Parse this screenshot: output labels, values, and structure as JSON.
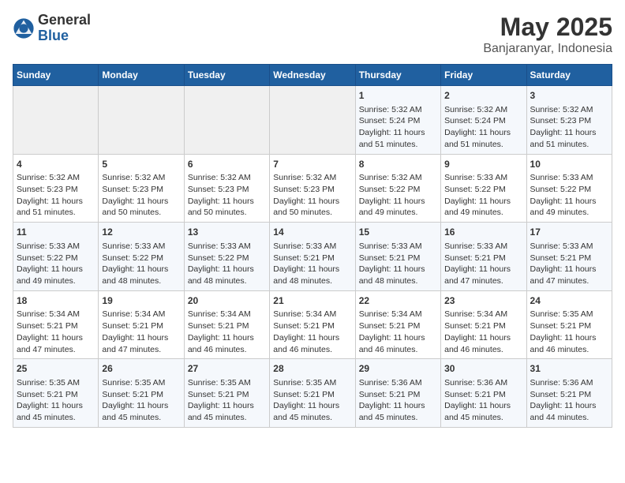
{
  "logo": {
    "general": "General",
    "blue": "Blue"
  },
  "title": "May 2025",
  "subtitle": "Banjaranyar, Indonesia",
  "days_of_week": [
    "Sunday",
    "Monday",
    "Tuesday",
    "Wednesday",
    "Thursday",
    "Friday",
    "Saturday"
  ],
  "weeks": [
    [
      {
        "day": "",
        "content": ""
      },
      {
        "day": "",
        "content": ""
      },
      {
        "day": "",
        "content": ""
      },
      {
        "day": "",
        "content": ""
      },
      {
        "day": "1",
        "content": "Sunrise: 5:32 AM\nSunset: 5:24 PM\nDaylight: 11 hours and 51 minutes."
      },
      {
        "day": "2",
        "content": "Sunrise: 5:32 AM\nSunset: 5:24 PM\nDaylight: 11 hours and 51 minutes."
      },
      {
        "day": "3",
        "content": "Sunrise: 5:32 AM\nSunset: 5:23 PM\nDaylight: 11 hours and 51 minutes."
      }
    ],
    [
      {
        "day": "4",
        "content": "Sunrise: 5:32 AM\nSunset: 5:23 PM\nDaylight: 11 hours and 51 minutes."
      },
      {
        "day": "5",
        "content": "Sunrise: 5:32 AM\nSunset: 5:23 PM\nDaylight: 11 hours and 50 minutes."
      },
      {
        "day": "6",
        "content": "Sunrise: 5:32 AM\nSunset: 5:23 PM\nDaylight: 11 hours and 50 minutes."
      },
      {
        "day": "7",
        "content": "Sunrise: 5:32 AM\nSunset: 5:23 PM\nDaylight: 11 hours and 50 minutes."
      },
      {
        "day": "8",
        "content": "Sunrise: 5:32 AM\nSunset: 5:22 PM\nDaylight: 11 hours and 49 minutes."
      },
      {
        "day": "9",
        "content": "Sunrise: 5:33 AM\nSunset: 5:22 PM\nDaylight: 11 hours and 49 minutes."
      },
      {
        "day": "10",
        "content": "Sunrise: 5:33 AM\nSunset: 5:22 PM\nDaylight: 11 hours and 49 minutes."
      }
    ],
    [
      {
        "day": "11",
        "content": "Sunrise: 5:33 AM\nSunset: 5:22 PM\nDaylight: 11 hours and 49 minutes."
      },
      {
        "day": "12",
        "content": "Sunrise: 5:33 AM\nSunset: 5:22 PM\nDaylight: 11 hours and 48 minutes."
      },
      {
        "day": "13",
        "content": "Sunrise: 5:33 AM\nSunset: 5:22 PM\nDaylight: 11 hours and 48 minutes."
      },
      {
        "day": "14",
        "content": "Sunrise: 5:33 AM\nSunset: 5:21 PM\nDaylight: 11 hours and 48 minutes."
      },
      {
        "day": "15",
        "content": "Sunrise: 5:33 AM\nSunset: 5:21 PM\nDaylight: 11 hours and 48 minutes."
      },
      {
        "day": "16",
        "content": "Sunrise: 5:33 AM\nSunset: 5:21 PM\nDaylight: 11 hours and 47 minutes."
      },
      {
        "day": "17",
        "content": "Sunrise: 5:33 AM\nSunset: 5:21 PM\nDaylight: 11 hours and 47 minutes."
      }
    ],
    [
      {
        "day": "18",
        "content": "Sunrise: 5:34 AM\nSunset: 5:21 PM\nDaylight: 11 hours and 47 minutes."
      },
      {
        "day": "19",
        "content": "Sunrise: 5:34 AM\nSunset: 5:21 PM\nDaylight: 11 hours and 47 minutes."
      },
      {
        "day": "20",
        "content": "Sunrise: 5:34 AM\nSunset: 5:21 PM\nDaylight: 11 hours and 46 minutes."
      },
      {
        "day": "21",
        "content": "Sunrise: 5:34 AM\nSunset: 5:21 PM\nDaylight: 11 hours and 46 minutes."
      },
      {
        "day": "22",
        "content": "Sunrise: 5:34 AM\nSunset: 5:21 PM\nDaylight: 11 hours and 46 minutes."
      },
      {
        "day": "23",
        "content": "Sunrise: 5:34 AM\nSunset: 5:21 PM\nDaylight: 11 hours and 46 minutes."
      },
      {
        "day": "24",
        "content": "Sunrise: 5:35 AM\nSunset: 5:21 PM\nDaylight: 11 hours and 46 minutes."
      }
    ],
    [
      {
        "day": "25",
        "content": "Sunrise: 5:35 AM\nSunset: 5:21 PM\nDaylight: 11 hours and 45 minutes."
      },
      {
        "day": "26",
        "content": "Sunrise: 5:35 AM\nSunset: 5:21 PM\nDaylight: 11 hours and 45 minutes."
      },
      {
        "day": "27",
        "content": "Sunrise: 5:35 AM\nSunset: 5:21 PM\nDaylight: 11 hours and 45 minutes."
      },
      {
        "day": "28",
        "content": "Sunrise: 5:35 AM\nSunset: 5:21 PM\nDaylight: 11 hours and 45 minutes."
      },
      {
        "day": "29",
        "content": "Sunrise: 5:36 AM\nSunset: 5:21 PM\nDaylight: 11 hours and 45 minutes."
      },
      {
        "day": "30",
        "content": "Sunrise: 5:36 AM\nSunset: 5:21 PM\nDaylight: 11 hours and 45 minutes."
      },
      {
        "day": "31",
        "content": "Sunrise: 5:36 AM\nSunset: 5:21 PM\nDaylight: 11 hours and 44 minutes."
      }
    ]
  ]
}
